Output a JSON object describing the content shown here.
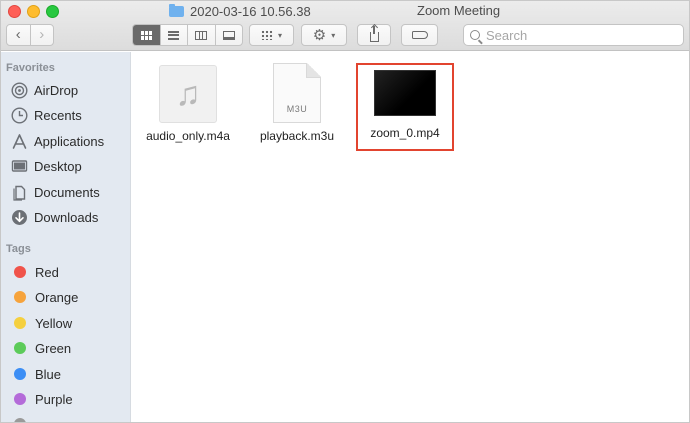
{
  "window": {
    "folder_title": "2020-03-16 10.56.38",
    "app_title": "Zoom Meeting"
  },
  "toolbar": {
    "back": "‹",
    "forward": "›",
    "gear": "⚙",
    "caret": "▾",
    "search_placeholder": "Search"
  },
  "sidebar": {
    "favorites_header": "Favorites",
    "favorites": [
      {
        "label": "AirDrop",
        "icon": "airdrop-icon"
      },
      {
        "label": "Recents",
        "icon": "clock-icon"
      },
      {
        "label": "Applications",
        "icon": "applications-icon"
      },
      {
        "label": "Desktop",
        "icon": "desktop-icon"
      },
      {
        "label": "Documents",
        "icon": "document-icon"
      },
      {
        "label": "Downloads",
        "icon": "download-icon"
      }
    ],
    "tags_header": "Tags",
    "tags": [
      {
        "label": "Red",
        "color": "#f0534a"
      },
      {
        "label": "Orange",
        "color": "#f6a33c"
      },
      {
        "label": "Yellow",
        "color": "#f5d03f"
      },
      {
        "label": "Green",
        "color": "#5ccb5a"
      },
      {
        "label": "Blue",
        "color": "#3c8ef5"
      },
      {
        "label": "Purple",
        "color": "#b46bd9"
      }
    ]
  },
  "files": [
    {
      "name": "audio_only.m4a",
      "icon": "music-note-icon"
    },
    {
      "name": "playback.m3u",
      "ext": "M3U"
    },
    {
      "name": "zoom_0.mp4",
      "highlight_color": "#e2442f"
    }
  ]
}
